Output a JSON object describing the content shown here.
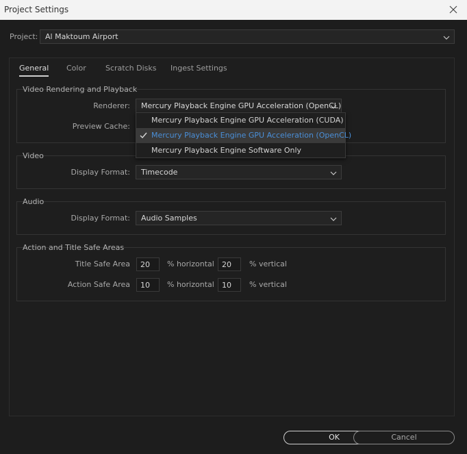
{
  "window": {
    "title": "Project Settings"
  },
  "project": {
    "label": "Project:",
    "value": "Al Maktoum Airport"
  },
  "tabs": [
    {
      "label": "General",
      "active": true
    },
    {
      "label": "Color"
    },
    {
      "label": "Scratch Disks"
    },
    {
      "label": "Ingest Settings"
    }
  ],
  "video_rendering": {
    "title": "Video Rendering and Playback",
    "renderer_label": "Renderer:",
    "renderer_value": "Mercury Playback Engine GPU Acceleration (OpenCL)",
    "preview_cache_label": "Preview Cache:",
    "menu_items": [
      {
        "label": "Mercury Playback Engine GPU Acceleration (CUDA)"
      },
      {
        "label": "Mercury Playback Engine GPU Acceleration (OpenCL)",
        "selected": true
      },
      {
        "label": "Mercury Playback Engine Software Only"
      }
    ]
  },
  "video": {
    "title": "Video",
    "display_format_label": "Display Format:",
    "display_format_value": "Timecode"
  },
  "audio": {
    "title": "Audio",
    "display_format_label": "Display Format:",
    "display_format_value": "Audio Samples"
  },
  "safe_areas": {
    "title": "Action and Title Safe Areas",
    "title_safe_label": "Title Safe Area",
    "title_safe_h": "20",
    "title_safe_v": "20",
    "action_safe_label": "Action Safe Area",
    "action_safe_h": "10",
    "action_safe_v": "10",
    "horizontal_unit": "% horizontal",
    "vertical_unit": "% vertical"
  },
  "buttons": {
    "ok": "OK",
    "cancel": "Cancel"
  },
  "colors": {
    "accent": "#4a8fd8",
    "background": "#1d1d1d",
    "titlebar": "#f3f3f3"
  }
}
